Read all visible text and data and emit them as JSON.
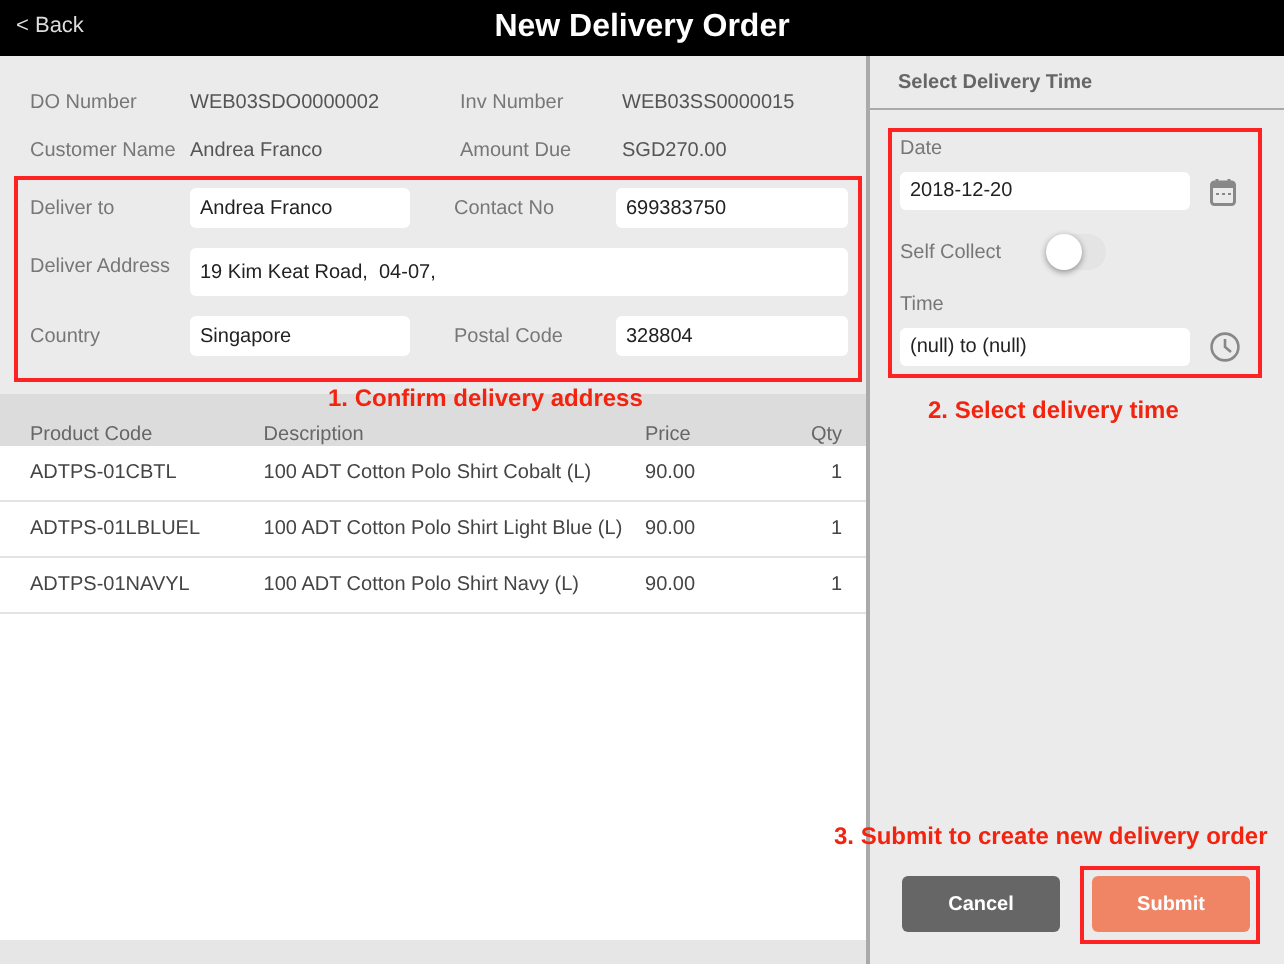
{
  "header": {
    "back": "< Back",
    "title": "New Delivery Order"
  },
  "order_info": [
    {
      "label": "DO Number",
      "value": "WEB03SDO0000002"
    },
    {
      "label": "Inv Number",
      "value": "WEB03SS0000015"
    },
    {
      "label": "Customer Name",
      "value": "Andrea Franco"
    },
    {
      "label": "Amount Due",
      "value": "SGD270.00"
    }
  ],
  "delivery_fields": {
    "deliver_to": {
      "label": "Deliver to",
      "value": "Andrea Franco"
    },
    "contact_no": {
      "label": "Contact No",
      "value": "699383750"
    },
    "address": {
      "label": "Deliver Address",
      "value": "19 Kim Keat Road,  04-07,"
    },
    "country": {
      "label": "Country",
      "value": "Singapore"
    },
    "postal_code": {
      "label": "Postal Code",
      "value": "328804"
    }
  },
  "table": {
    "columns": [
      "Product Code",
      "Description",
      "Price",
      "Qty"
    ],
    "rows": [
      [
        "ADTPS-01CBTL",
        "100 ADT Cotton Polo Shirt Cobalt (L)",
        "90.00",
        "1"
      ],
      [
        "ADTPS-01LBLUEL",
        "100 ADT Cotton Polo Shirt Light Blue (L)",
        "90.00",
        "1"
      ],
      [
        "ADTPS-01NAVYL",
        "100 ADT Cotton Polo Shirt Navy (L)",
        "90.00",
        "1"
      ]
    ]
  },
  "time_panel": {
    "title": "Select Delivery Time",
    "date": {
      "label": "Date",
      "value": "2018-12-20"
    },
    "self_collect": {
      "label": "Self Collect",
      "on": false
    },
    "time": {
      "label": "Time",
      "value": "(null) to (null)"
    }
  },
  "buttons": [
    {
      "label": "Cancel",
      "kind": "cancel"
    },
    {
      "label": "Submit",
      "kind": "primary"
    }
  ],
  "annotations": [
    "1. Confirm delivery address",
    "2. Select delivery time",
    "3. Submit to create new delivery order"
  ]
}
